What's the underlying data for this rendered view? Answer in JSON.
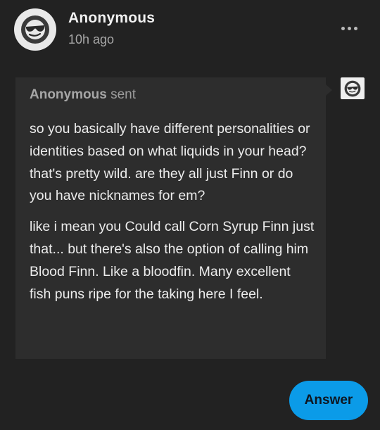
{
  "post": {
    "author_name": "Anonymous",
    "timestamp": "10h ago",
    "avatar_icon": "anonymous-sunglasses-icon",
    "more_icon": "ellipsis-icon"
  },
  "ask": {
    "sender_name": "Anonymous",
    "sender_verb": "sent",
    "paragraphs": [
      "so you basically have different personalities or identities based on what liquids in your head? that's pretty wild. are they all just Finn or do you have nicknames for em?",
      "like i mean you Could call Corn Syrup Finn just that... but there's also the option of calling him Blood Finn. Like a bloodfin. Many excellent fish puns ripe for the taking here I feel."
    ],
    "recipient_avatar_icon": "anonymous-sunglasses-icon"
  },
  "actions": {
    "answer_label": "Answer"
  },
  "colors": {
    "background": "#222222",
    "bubble": "#2d2d2d",
    "accent": "#0b9be8"
  }
}
